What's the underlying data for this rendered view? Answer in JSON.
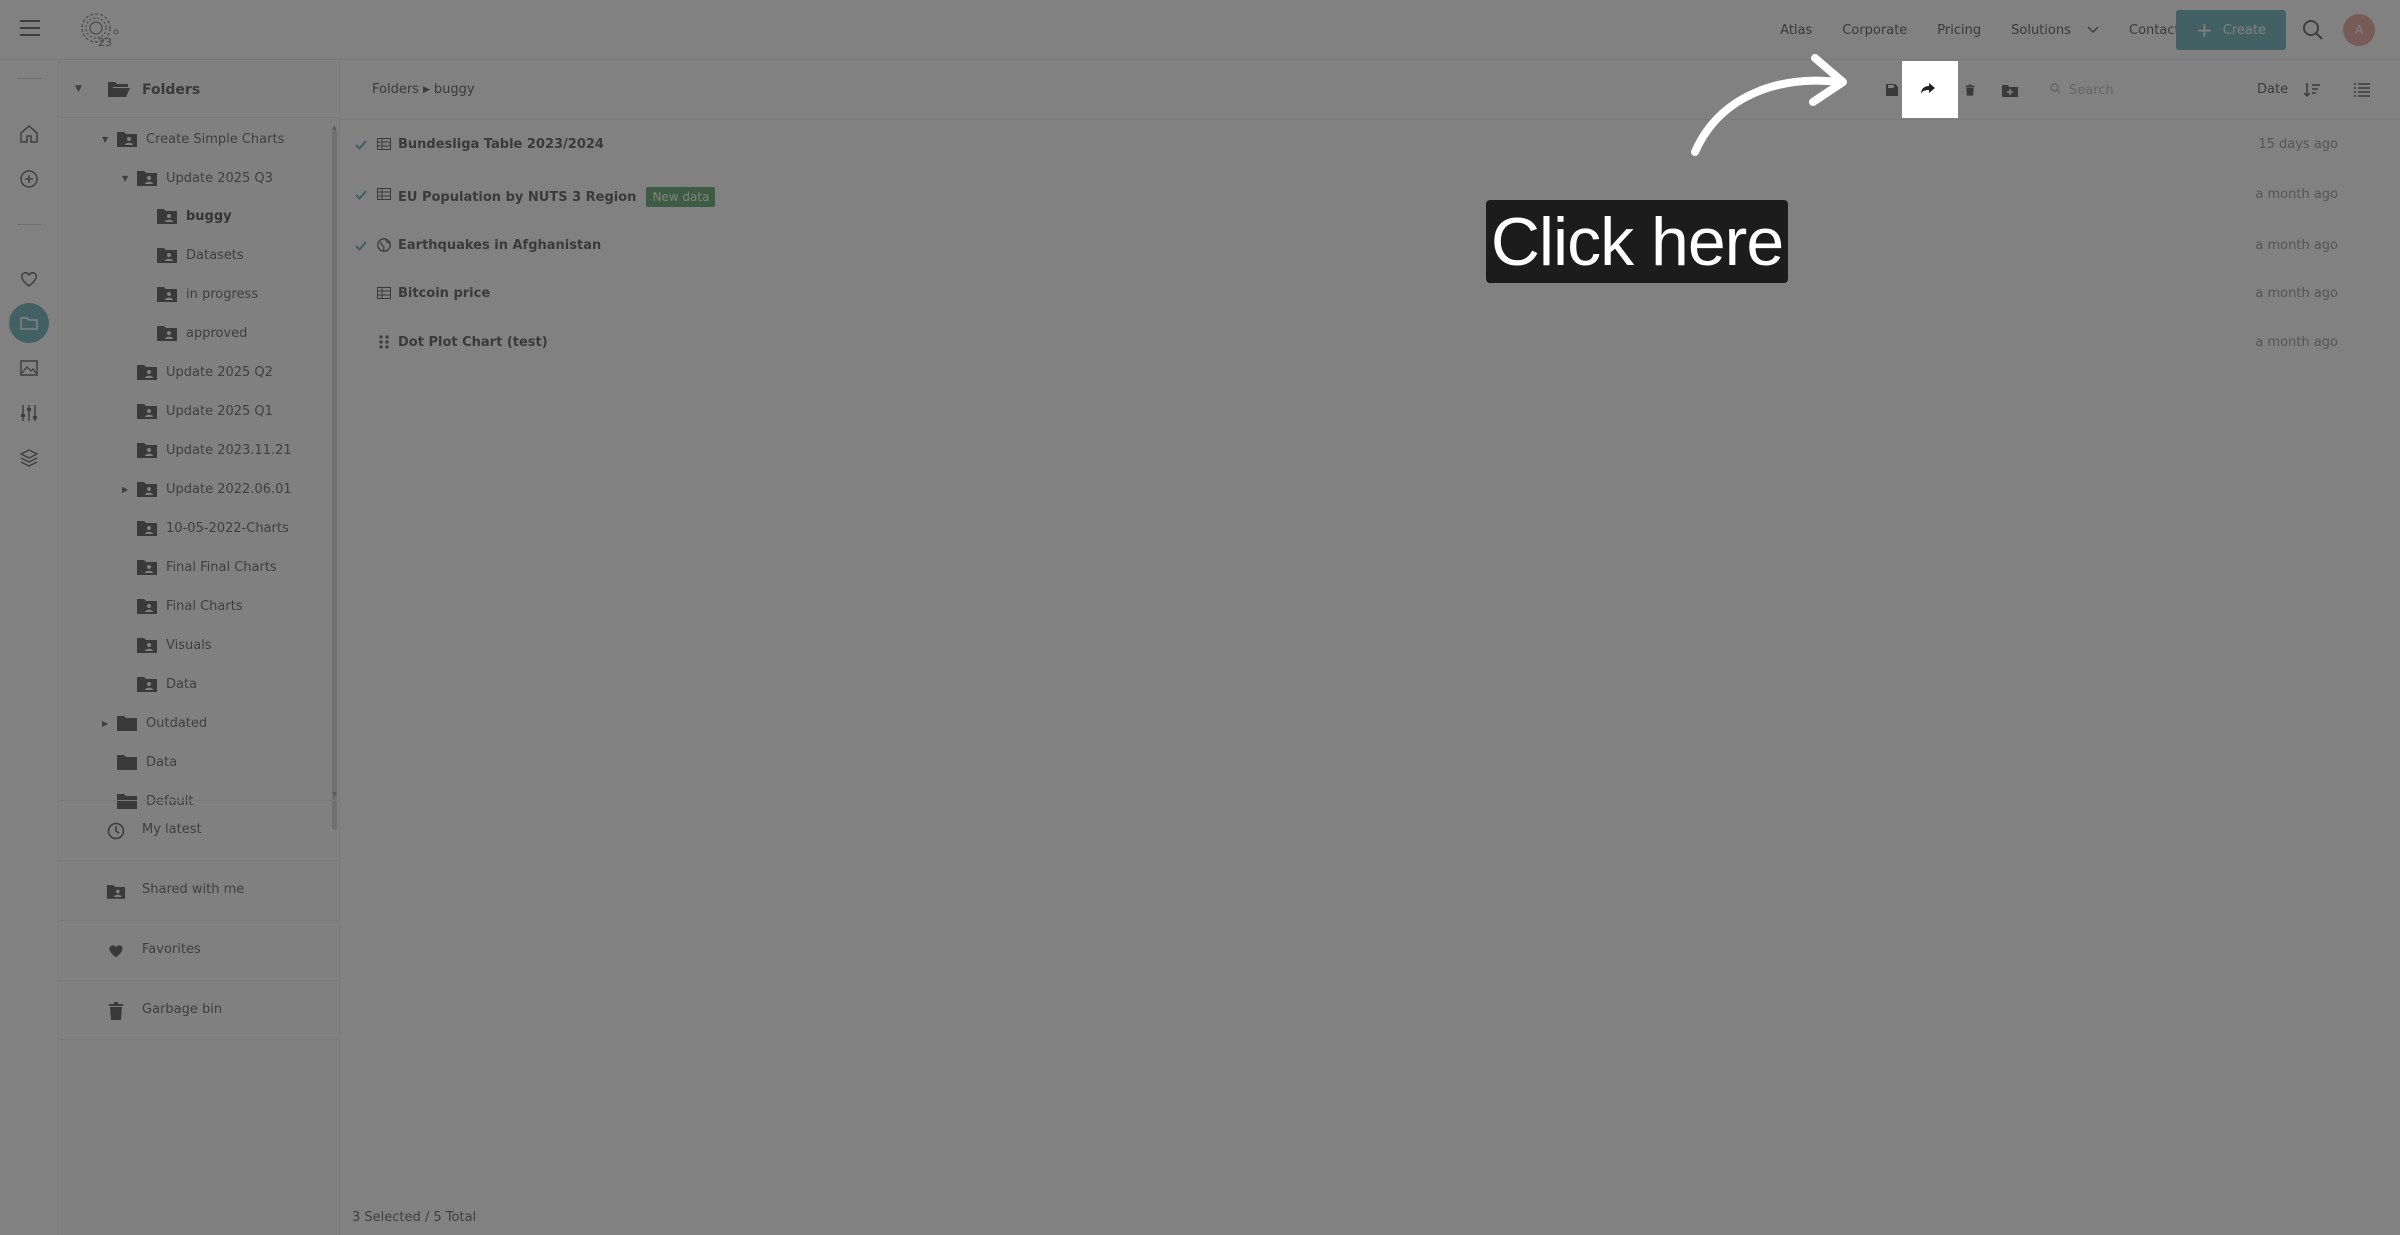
{
  "topnav": {
    "items": [
      "Atlas",
      "Corporate",
      "Pricing",
      "Solutions",
      "Contact Us"
    ],
    "create_label": "Create",
    "avatar_initial": "A",
    "accent_color": "#3e9aa8"
  },
  "tree": {
    "header": "Folders",
    "items": [
      {
        "label": "Create Simple Charts"
      },
      {
        "label": "Update 2025 Q3"
      },
      {
        "label": "buggy"
      },
      {
        "label": "Datasets"
      },
      {
        "label": "in progress"
      },
      {
        "label": "approved"
      },
      {
        "label": "Update 2025 Q2"
      },
      {
        "label": "Update 2025 Q1"
      },
      {
        "label": "Update 2023.11.21"
      },
      {
        "label": "Update 2022.06.01"
      },
      {
        "label": "10-05-2022-Charts"
      },
      {
        "label": "Final Final Charts"
      },
      {
        "label": "Final Charts"
      },
      {
        "label": "Visuals"
      },
      {
        "label": "Data"
      },
      {
        "label": "Outdated"
      },
      {
        "label": "Data"
      },
      {
        "label": "Default"
      }
    ],
    "quick": [
      {
        "label": "My latest",
        "icon": "clock-icon"
      },
      {
        "label": "Shared with me",
        "icon": "shared-folder-icon"
      },
      {
        "label": "Favorites",
        "icon": "heart-icon"
      },
      {
        "label": "Garbage bin",
        "icon": "trash-icon"
      }
    ]
  },
  "main": {
    "breadcrumb": [
      "Folders",
      "buggy"
    ],
    "search_placeholder": "Search",
    "sort_label": "Date",
    "rows": [
      {
        "name": "Bundesliga Table 2023/2024",
        "date": "15 days ago",
        "checked": true,
        "icon": "table-icon",
        "badge": ""
      },
      {
        "name": "EU Population by NUTS 3 Region",
        "date": "a month ago",
        "checked": true,
        "icon": "table-icon",
        "badge": "New data"
      },
      {
        "name": "Earthquakes in Afghanistan",
        "date": "a month ago",
        "checked": true,
        "icon": "globe-icon",
        "badge": ""
      },
      {
        "name": "Bitcoin price",
        "date": "a month ago",
        "checked": false,
        "icon": "table-icon",
        "badge": ""
      },
      {
        "name": "Dot Plot Chart (test)",
        "date": "a month ago",
        "checked": false,
        "icon": "dot-plot-icon",
        "badge": ""
      }
    ],
    "footer": "3 Selected / 5 Total"
  },
  "overlay": {
    "callout_text": "Click here",
    "highlight_target": "share-icon"
  }
}
